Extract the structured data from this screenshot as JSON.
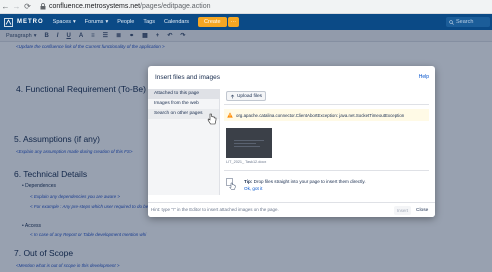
{
  "browser": {
    "url_domain": "confluence.metrosystems.net",
    "url_path": "/pages/editpage.action"
  },
  "app": {
    "brand": "METRO",
    "nav": [
      "Spaces",
      "Forums",
      "People",
      "Tags",
      "Calendars"
    ],
    "create_label": "Create",
    "search_placeholder": "Search",
    "accent_color": "#0b4a86"
  },
  "toolbar": {
    "paragraph_label": "Paragraph",
    "buttons": [
      "B",
      "I",
      "U",
      "A"
    ]
  },
  "content": {
    "note_top": "<Update the confluence link of the Current functionality of the application >",
    "h4": "4.    Functional Requirement (To-Be)",
    "h5": "5. Assumptions (if any)",
    "note_assumptions": "<Explain any assumption made during creation of this FS>",
    "h6": "6. Technical Details",
    "dependencies_label": "Dependences",
    "note_dependencies": "< Explain any dependencies you are aware >",
    "note_example": "< For example : Any pre-steps which user required to do be",
    "access_label": "Access",
    "note_access": "< In case of any Report or Table development mention whi",
    "h7": "7. Out of Scope",
    "note_scope": "<Mention what is out of scope in this development >"
  },
  "dialog": {
    "title": "Insert files and images",
    "help": "Help",
    "sidebar": [
      "Attached to this page",
      "Images from the web",
      "Search on other pages"
    ],
    "upload_label": "Upload files",
    "warning": "org.apache.catalina.connector.ClientAbortException: java.net.SocketTimeoutException",
    "thumb_label": "LIT_2021_ Task12.docx",
    "tip_bold": "Tip:",
    "tip_text": "Drop files straight into your page to insert them directly.",
    "tip_link": "Ok, got it",
    "footer_hint": "Hint: type \"!\" in the Editor to insert attached images on the page.",
    "insert_label": "Insert",
    "close_label": "Close"
  }
}
